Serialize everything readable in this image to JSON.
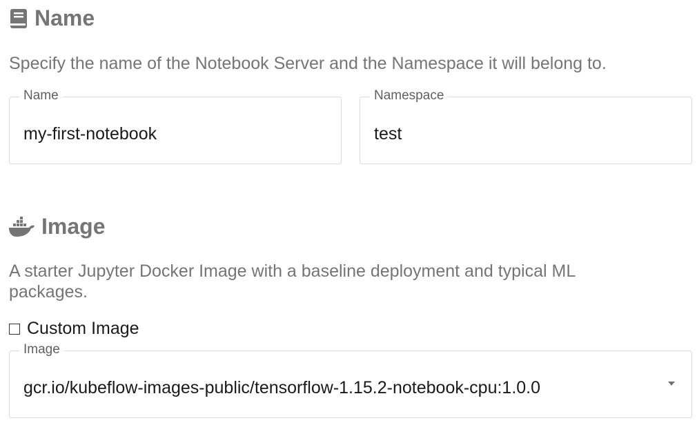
{
  "name_section": {
    "title": "Name",
    "icon": "book-icon",
    "description": "Specify the name of the Notebook Server and the Namespace it will belong to.",
    "name_field": {
      "label": "Name",
      "value": "my-first-notebook"
    },
    "namespace_field": {
      "label": "Namespace",
      "value": "test"
    }
  },
  "image_section": {
    "title": "Image",
    "icon": "docker-icon",
    "description": "A starter Jupyter Docker Image with a baseline deployment and typical ML packages.",
    "custom_image_checkbox": {
      "label": "Custom Image",
      "checked": false
    },
    "image_select": {
      "label": "Image",
      "value": "gcr.io/kubeflow-images-public/tensorflow-1.15.2-notebook-cpu:1.0.0"
    }
  },
  "colors": {
    "heading": "#757575",
    "description": "#757575",
    "field_border": "#dcdcdc",
    "text": "#1a1a1a"
  }
}
